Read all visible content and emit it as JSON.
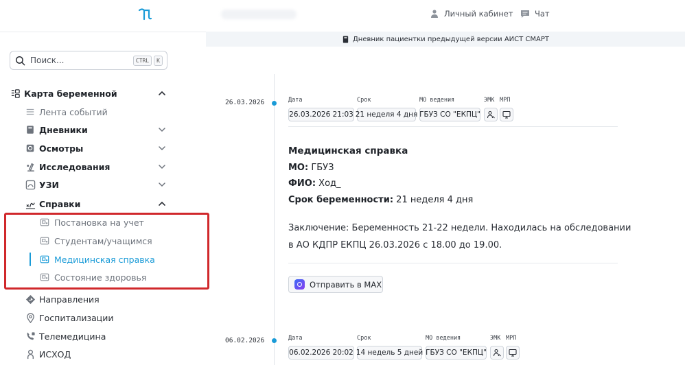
{
  "search": {
    "placeholder": "Поиск...",
    "shortcut": [
      "CTRL",
      "K"
    ]
  },
  "header": {
    "cabinet_label": "Личный кабинет",
    "chat_label": "Чат",
    "banner_text": "Дневник пациентки предыдущей версии АИСТ СМАРТ"
  },
  "sidebar": {
    "root": {
      "label": "Карта беременной",
      "expanded": true
    },
    "items": [
      {
        "label": "Лента событий",
        "icon": "list-icon"
      },
      {
        "label": "Дневники",
        "icon": "diary-icon",
        "expandable": true
      },
      {
        "label": "Осмотры",
        "icon": "exam-icon",
        "expandable": true
      },
      {
        "label": "Исследования",
        "icon": "research-icon",
        "expandable": true
      },
      {
        "label": "УЗИ",
        "icon": "ultrasound-icon",
        "expandable": true
      },
      {
        "label": "Справки",
        "icon": "certificate-icon",
        "expanded": true
      },
      {
        "label": "Направления",
        "icon": "direction-icon"
      },
      {
        "label": "Госпитализации",
        "icon": "location-icon"
      },
      {
        "label": "Телемедицина",
        "icon": "telemedicine-icon"
      },
      {
        "label": "ИСХОД",
        "icon": "outcome-icon"
      }
    ],
    "certificate_subitems": [
      {
        "label": "Постановка на учет"
      },
      {
        "label": "Студентам/учащимся"
      },
      {
        "label": "Медицинская справка",
        "active": true
      },
      {
        "label": "Состояние здоровья"
      }
    ],
    "accent_color": "#1a9bd7",
    "highlight_color": "#d0282b"
  },
  "labels": {
    "date": "Дата",
    "term": "Срок",
    "mo": "МО ведения",
    "emk": "ЭМК",
    "mrp": "МРП"
  },
  "entries": [
    {
      "timeline_date": "26.03.2026",
      "datetime": "26.03.2026 21:03",
      "term": "21 неделя 4 дня",
      "mo": "ГБУЗ СО \"ЕКПЦ\"",
      "document": {
        "title": "Медицинская справка",
        "mo_label": "МО:",
        "mo_value": "ГБУЗ",
        "fio_label": "ФИО:",
        "fio_value": "Ход_",
        "term_label": "Срок беременности:",
        "term_value": "21 неделя 4 дня",
        "conclusion": "Заключение: Беременность 21-22 недели. Находилась на обследовании в АО КДПР ЕКПЦ 26.03.2026 с 18.00 до 19.00."
      },
      "send_button": "Отправить в MAX"
    },
    {
      "timeline_date": "06.02.2026",
      "datetime": "06.02.2026 20:02",
      "term": "14 недель 5 дней",
      "mo": "ГБУЗ СО \"ЕКПЦ\""
    }
  ]
}
